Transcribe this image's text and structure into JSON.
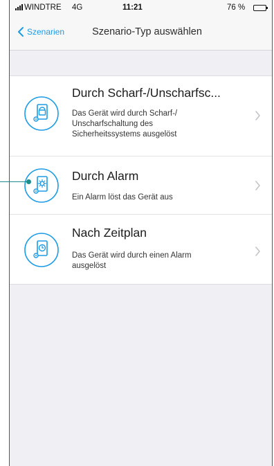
{
  "status_bar": {
    "carrier": "WINDTRE",
    "network": "4G",
    "time": "11:21",
    "battery": "76 %",
    "battery_level": 0.76
  },
  "nav": {
    "back_label": "Szenarien",
    "title": "Szenario-Typ auswählen"
  },
  "colors": {
    "accent": "#1b9be5",
    "callout": "#1a8d8c"
  },
  "scenario_types": [
    {
      "title": "Durch Scharf-/Unscharfsc...",
      "description": "Das Gerät wird durch Scharf-/ Unscharfschaltung des Sicherheitssystems ausgelöst",
      "icon": "arm-disarm-device-icon"
    },
    {
      "title": "Durch Alarm",
      "description": "Ein Alarm löst das Gerät aus",
      "icon": "alarm-device-icon"
    },
    {
      "title": "Nach Zeitplan",
      "description": "Das Gerät wird durch einen Alarm ausgelöst",
      "icon": "schedule-device-icon"
    }
  ]
}
